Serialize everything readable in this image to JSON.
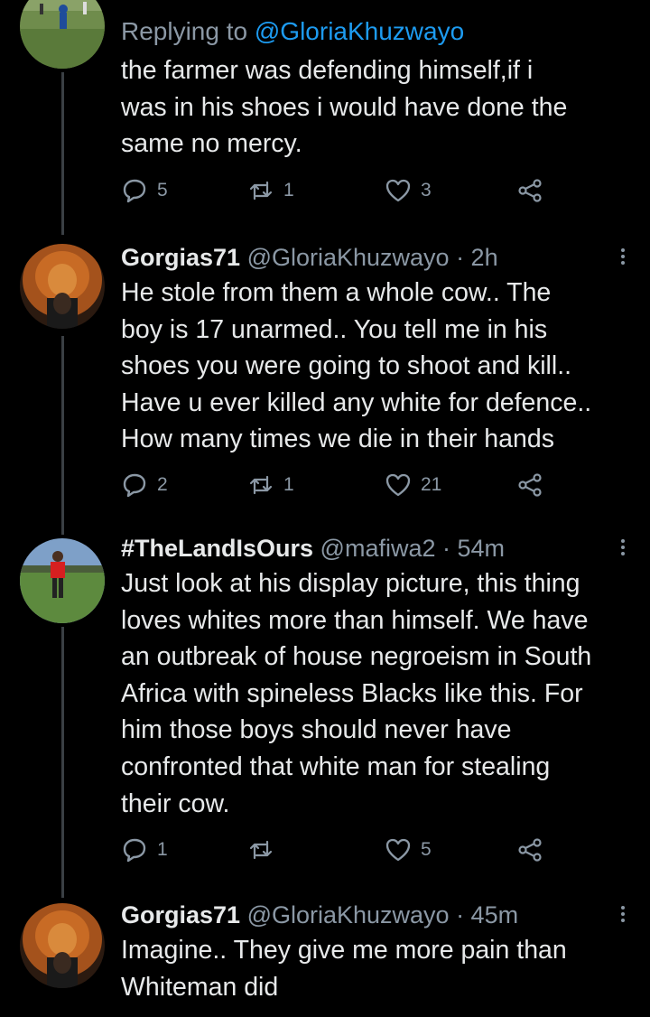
{
  "colors": {
    "background": "#000000",
    "text": "#e7e9ea",
    "muted": "#8b98a5",
    "link": "#1d9bf0",
    "thread_line": "#3a3f44"
  },
  "tweets": [
    {
      "reply_prefix": "Replying to ",
      "reply_mention": "@GloriaKhuzwayo",
      "lines": [
        "the farmer was defending  himself,if i",
        "was in his shoes i would have done the",
        "same no mercy."
      ],
      "replies": "5",
      "retweets": "1",
      "likes": "3"
    },
    {
      "name": "Gorgias71",
      "meta": " @GloriaKhuzwayo · 2h",
      "lines": [
        "He stole from them a whole cow.. The",
        "boy is 17 unarmed.. You tell me in his",
        "shoes you were going to shoot and kill..",
        "Have u ever killed any white for defence..",
        "How many times we die in their hands"
      ],
      "replies": "2",
      "retweets": "1",
      "likes": "21"
    },
    {
      "name": "#TheLandIsOurs",
      "meta": " @mafiwa2 · 54m",
      "lines": [
        "Just look at his display picture, this thing",
        "loves whites more than himself. We have",
        "an outbreak of house negroeism in South",
        "Africa with spineless Blacks like this. For",
        "him those boys should never have",
        "confronted that white man for stealing",
        "their cow."
      ],
      "replies": "1",
      "retweets": "",
      "likes": "5"
    },
    {
      "name": "Gorgias71",
      "meta": " @GloriaKhuzwayo · 45m",
      "lines": [
        "Imagine.. They give me more pain than",
        "Whiteman did"
      ]
    }
  ]
}
